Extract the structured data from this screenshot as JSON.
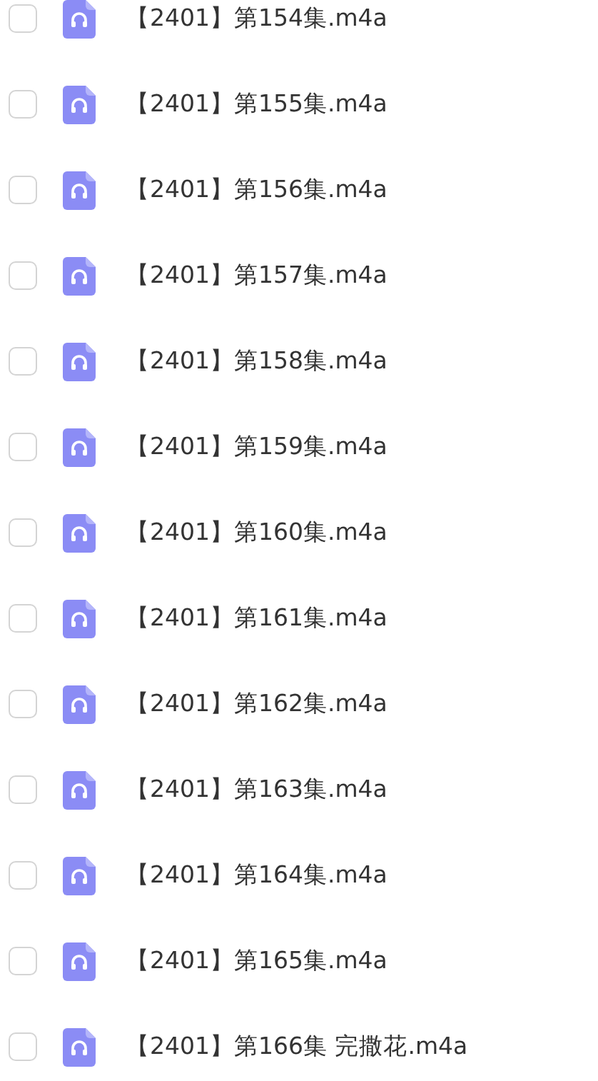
{
  "files": [
    {
      "name": "【2401】第154集.m4a",
      "checked": false
    },
    {
      "name": "【2401】第155集.m4a",
      "checked": false
    },
    {
      "name": "【2401】第156集.m4a",
      "checked": false
    },
    {
      "name": "【2401】第157集.m4a",
      "checked": false
    },
    {
      "name": "【2401】第158集.m4a",
      "checked": false
    },
    {
      "name": "【2401】第159集.m4a",
      "checked": false
    },
    {
      "name": "【2401】第160集.m4a",
      "checked": false
    },
    {
      "name": "【2401】第161集.m4a",
      "checked": false
    },
    {
      "name": "【2401】第162集.m4a",
      "checked": false
    },
    {
      "name": "【2401】第163集.m4a",
      "checked": false
    },
    {
      "name": "【2401】第164集.m4a",
      "checked": false
    },
    {
      "name": "【2401】第165集.m4a",
      "checked": false
    },
    {
      "name": "【2401】第166集 完撒花.m4a",
      "checked": false
    }
  ]
}
